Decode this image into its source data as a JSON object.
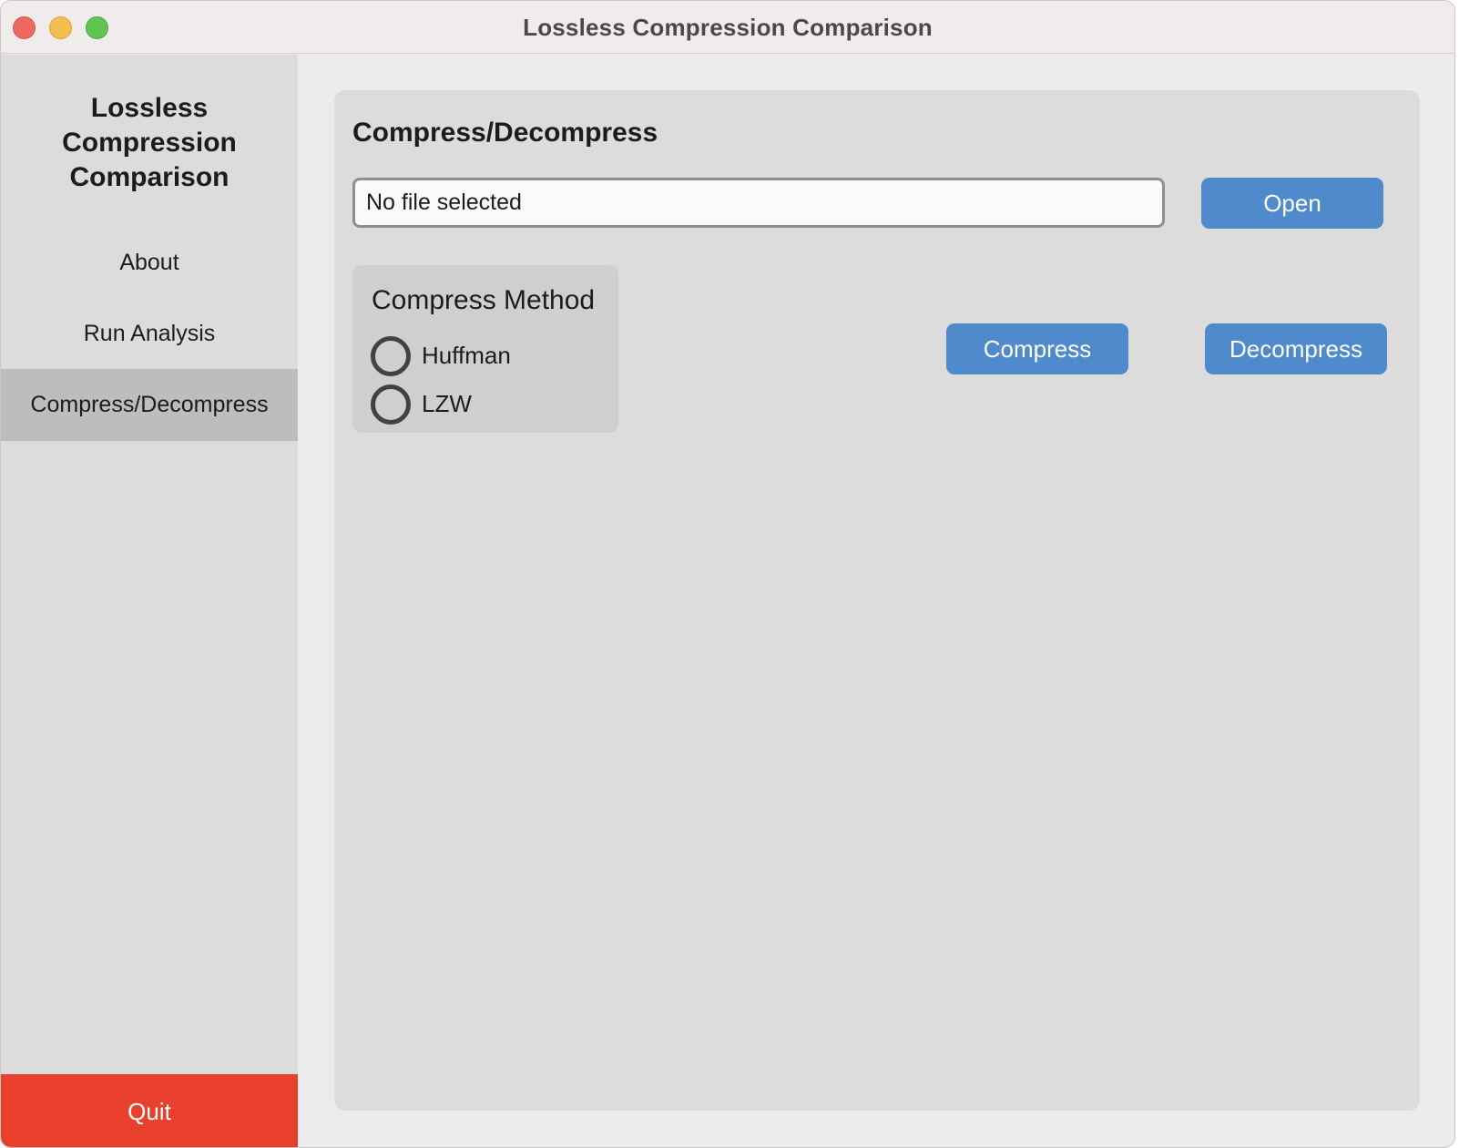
{
  "window": {
    "title": "Lossless Compression Comparison"
  },
  "sidebar": {
    "app_title_lines": [
      "Lossless",
      "Compression",
      "Comparison"
    ],
    "items": [
      {
        "label": "About",
        "active": false
      },
      {
        "label": "Run Analysis",
        "active": false
      },
      {
        "label": "Compress/Decompress",
        "active": true
      }
    ],
    "quit_label": "Quit"
  },
  "main": {
    "title": "Compress/Decompress",
    "file_field": {
      "value": "No file selected"
    },
    "open_label": "Open",
    "method_group": {
      "title": "Compress Method",
      "options": [
        {
          "label": "Huffman",
          "selected": false
        },
        {
          "label": "LZW",
          "selected": false
        }
      ]
    },
    "compress_label": "Compress",
    "decompress_label": "Decompress"
  },
  "colors": {
    "accent": "#4f8bcc",
    "quit": "#e8402d",
    "sidebar_active": "#bdbdbd"
  }
}
